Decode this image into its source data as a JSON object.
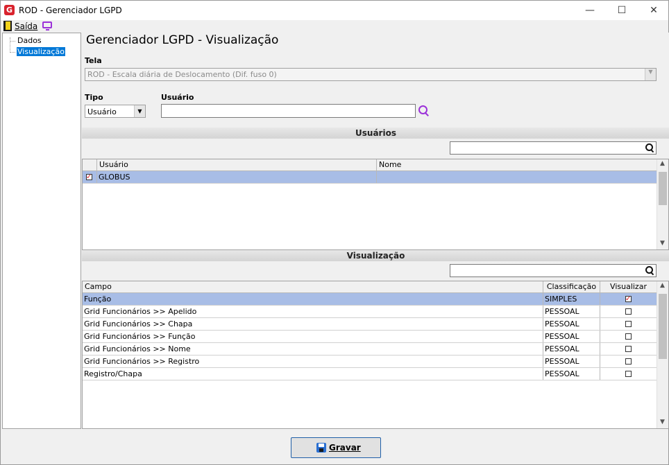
{
  "window": {
    "title": "ROD - Gerenciador LGPD",
    "logo_letter": "G"
  },
  "window_controls": {
    "minimize": "—",
    "maximize": "☐",
    "close": "✕"
  },
  "menubar": {
    "exit_label": "Saída"
  },
  "tree": {
    "items": [
      "Dados",
      "Visualização"
    ]
  },
  "page": {
    "title": "Gerenciador LGPD - Visualização"
  },
  "tela": {
    "label": "Tela",
    "value": "ROD - Escala diária de Deslocamento (Dif. fuso 0)"
  },
  "tipo": {
    "label": "Tipo",
    "value": "Usuário"
  },
  "usuario": {
    "label": "Usuário",
    "value": ""
  },
  "users_section": {
    "title": "Usuários",
    "search_value": "",
    "columns": [
      "Usuário",
      "Nome"
    ],
    "rows": [
      {
        "checked": true,
        "user": "GLOBUS",
        "name": ""
      }
    ]
  },
  "view_section": {
    "title": "Visualização",
    "search_value": "",
    "columns": [
      "Campo",
      "Classificação",
      "Visualizar"
    ],
    "rows": [
      {
        "campo": "Função",
        "classificacao": "SIMPLES",
        "visualizar": true
      },
      {
        "campo": "Grid Funcionários >> Apelido",
        "classificacao": "PESSOAL",
        "visualizar": false
      },
      {
        "campo": "Grid Funcionários >> Chapa",
        "classificacao": "PESSOAL",
        "visualizar": false
      },
      {
        "campo": "Grid Funcionários >> Função",
        "classificacao": "PESSOAL",
        "visualizar": false
      },
      {
        "campo": "Grid Funcionários >> Nome",
        "classificacao": "PESSOAL",
        "visualizar": false
      },
      {
        "campo": "Grid Funcionários >> Registro",
        "classificacao": "PESSOAL",
        "visualizar": false
      },
      {
        "campo": "Registro/Chapa",
        "classificacao": "PESSOAL",
        "visualizar": false
      }
    ]
  },
  "footer": {
    "save_label": "Gravar"
  },
  "colors": {
    "selection": "#a8bde6",
    "accent_purple": "#9b30d9",
    "logo_red": "#d9232d"
  }
}
